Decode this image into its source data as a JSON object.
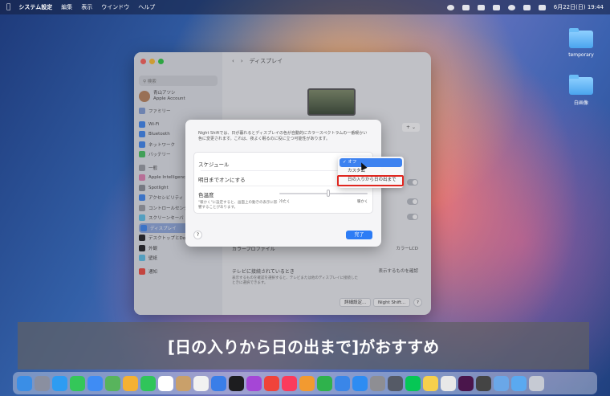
{
  "menubar": {
    "app": "システム設定",
    "items": [
      "編集",
      "表示",
      "ウインドウ",
      "ヘルプ"
    ],
    "datetime": "6月22日(日) 19:44"
  },
  "desktop": {
    "icons": [
      {
        "label": "temporary"
      },
      {
        "label": "白画像"
      }
    ]
  },
  "settings": {
    "title": "ディスプレイ",
    "search_placeholder": "検索",
    "account_name": "青山アツシ",
    "account_sub": "Apple Account",
    "family": "ファミリー",
    "sidebar": [
      "Wi-Fi",
      "Bluetooth",
      "ネットワーク",
      "バッテリー",
      "一般",
      "Apple Intelligence",
      "Spotlight",
      "アクセシビリティ",
      "コントロールセンター",
      "スクリーンセーバ",
      "ディスプレイ",
      "デスクトップとDock",
      "外観",
      "壁紙",
      "通知"
    ],
    "color_profile_label": "カラープロファイル",
    "color_profile_value": "カラーLCD",
    "tv_label": "テレビに接続されているとき",
    "tv_value": "表示するものを確認",
    "tv_sub": "表示するものを確認を選択すると、テレビまたは他のディスプレイに接続したときに選択できます。",
    "advanced_btn": "詳細設定...",
    "nightshift_btn": "Night Shift...",
    "help": "?"
  },
  "sheet": {
    "description": "Night Shiftでは、日が暮れるとディスプレイの色が自動的にカラースペクトラムの一番暖かい色に変更されます。これは、夜よく眠るのに役に立つ可能性があります。",
    "schedule_label": "スケジュール",
    "tomorrow_label": "明日までオンにする",
    "temp_label": "色温度",
    "temp_sub": "\"暖かく\"に設定すると、画面上の動きの表示に影響することがあります。",
    "slider_less": "冷たく",
    "slider_more": "暖かく",
    "slider_value": 0.52,
    "help": "?",
    "done": "完了"
  },
  "dropdown": {
    "options": [
      "✓ オフ",
      "カスタム",
      "日の入りから日の出まで"
    ],
    "selected_index": 0,
    "highlight_index": 2
  },
  "caption": "[日の入りから日の出まで]がおすすめ",
  "dock": {
    "apps": [
      {
        "name": "finder-app",
        "color": "#3a8ee6"
      },
      {
        "name": "launchpad-app",
        "color": "#8a8fa0"
      },
      {
        "name": "safari-app",
        "color": "#2d9cf2"
      },
      {
        "name": "messages-app",
        "color": "#34c759"
      },
      {
        "name": "mail-app",
        "color": "#3f8cf4"
      },
      {
        "name": "maps-app",
        "color": "#58b45c"
      },
      {
        "name": "photos-app",
        "color": "#f4b133"
      },
      {
        "name": "facetime-app",
        "color": "#30c55a"
      },
      {
        "name": "calendar-app",
        "color": "#ffffff"
      },
      {
        "name": "contacts-app",
        "color": "#c9a06a"
      },
      {
        "name": "reminders-app",
        "color": "#f1f1f1"
      },
      {
        "name": "freeform-app",
        "color": "#3a7ee8"
      },
      {
        "name": "tv-app",
        "color": "#1d1d1f"
      },
      {
        "name": "podcasts-app",
        "color": "#a546d6"
      },
      {
        "name": "news-app",
        "color": "#f0433a"
      },
      {
        "name": "music-app",
        "color": "#fb3b5c"
      },
      {
        "name": "pages-app",
        "color": "#f29a30"
      },
      {
        "name": "numbers-app",
        "color": "#2fb24c"
      },
      {
        "name": "keynote-app",
        "color": "#3a86e8"
      },
      {
        "name": "appstore-app",
        "color": "#2d8cf2"
      },
      {
        "name": "settings-app",
        "color": "#8e8e93"
      },
      {
        "name": "iphone-mirroring-app",
        "color": "#555a66"
      },
      {
        "name": "line-app",
        "color": "#06c755"
      },
      {
        "name": "notes-app",
        "color": "#f6d04d"
      },
      {
        "name": "chrome-app",
        "color": "#e8e8e8"
      },
      {
        "name": "slack-app",
        "color": "#4a154b"
      },
      {
        "name": "calculator-app",
        "color": "#444"
      },
      {
        "name": "preview-app",
        "color": "#6aa7e8"
      },
      {
        "name": "downloads-stack",
        "color": "#5aa9f0"
      },
      {
        "name": "trash",
        "color": "#c6cad3"
      }
    ]
  }
}
